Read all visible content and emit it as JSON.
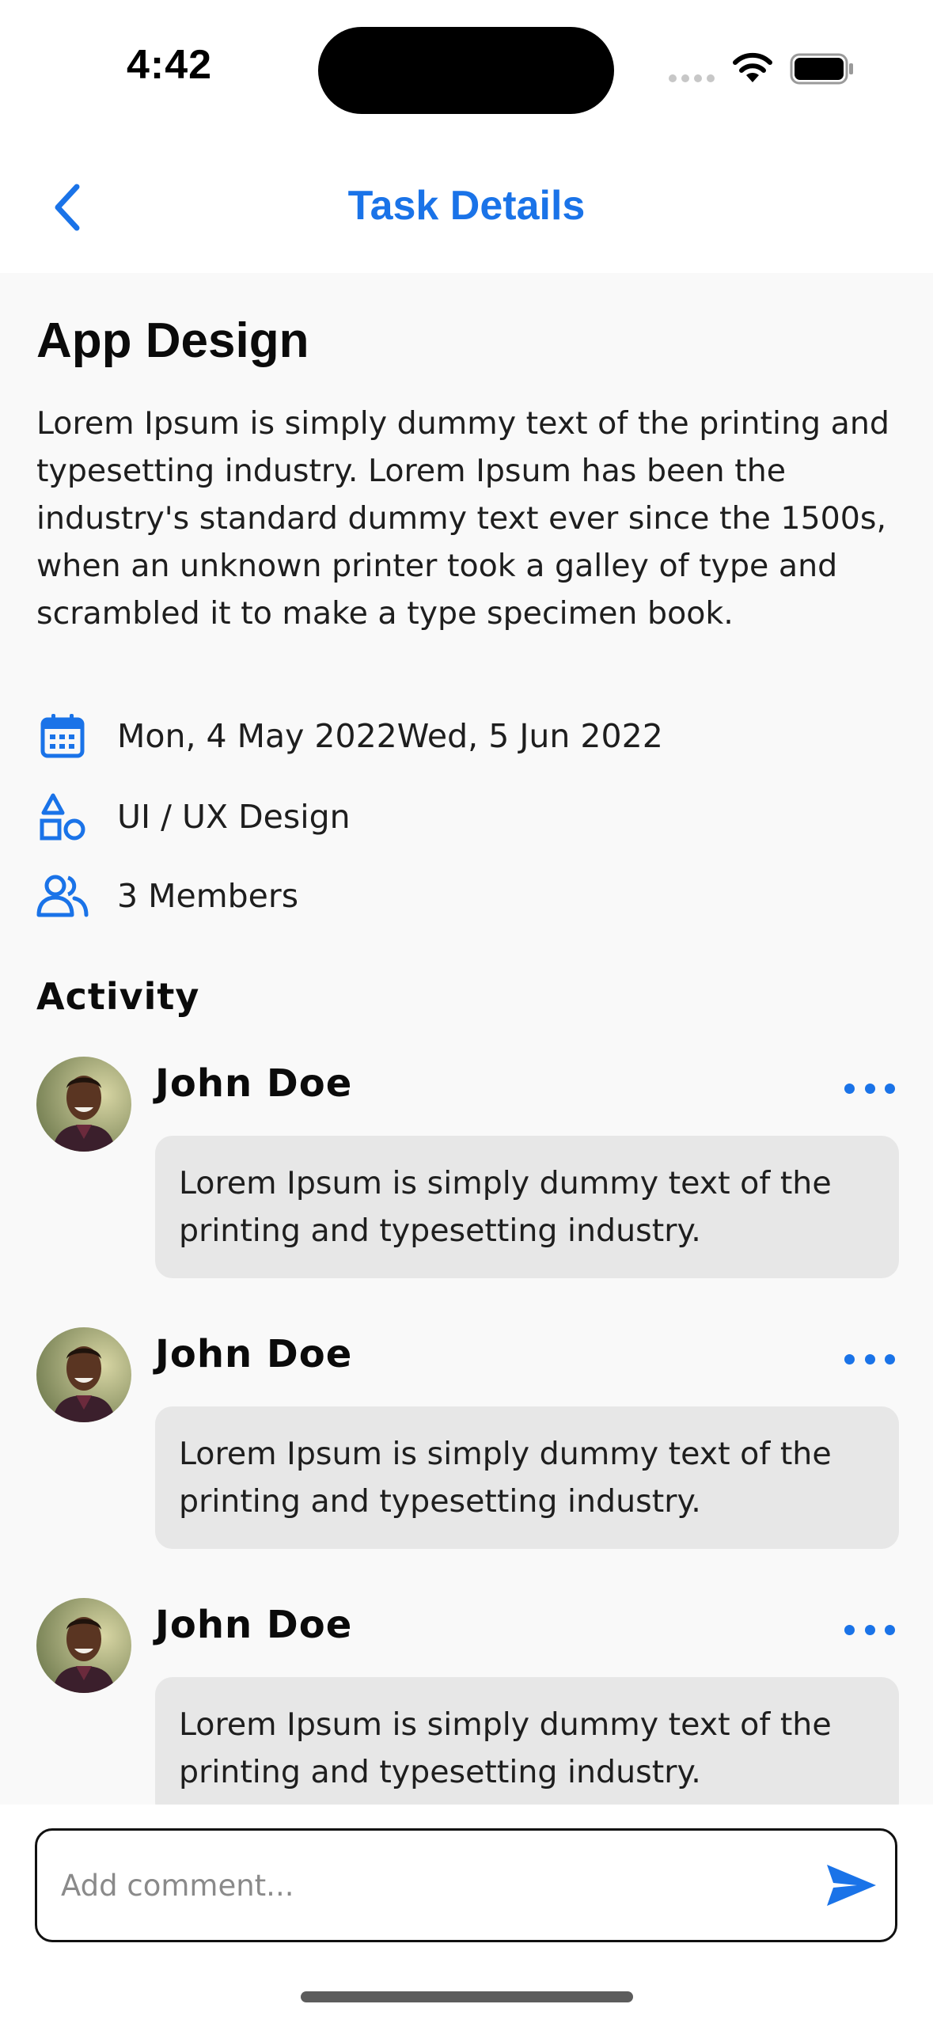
{
  "status_bar": {
    "time": "4:42",
    "icons": [
      "cellular-signal-icon",
      "wifi-icon",
      "battery-icon"
    ]
  },
  "nav": {
    "back_icon": "chevron-left-icon",
    "title": "Task Details"
  },
  "task": {
    "title": "App Design",
    "description": "Lorem Ipsum is simply dummy text of the printing and typesetting industry. Lorem Ipsum has been the industry's standard dummy text ever since the 1500s, when an unknown printer took a galley of type and scrambled it to make a type specimen book.",
    "meta": [
      {
        "icon": "calendar-icon",
        "text": "Mon, 4 May 2022Wed, 5 Jun 2022"
      },
      {
        "icon": "shapes-icon",
        "text": "UI / UX Design"
      },
      {
        "icon": "members-icon",
        "text": "3 Members"
      }
    ]
  },
  "activity": {
    "heading": "Activity",
    "comments": [
      {
        "author": "John Doe",
        "text": "Lorem Ipsum is simply dummy text of the printing and typesetting industry."
      },
      {
        "author": "John Doe",
        "text": "Lorem Ipsum is simply dummy text of the printing and typesetting industry."
      },
      {
        "author": "John Doe",
        "text": "Lorem Ipsum is simply dummy text of the printing and typesetting industry."
      }
    ]
  },
  "comment_bar": {
    "placeholder": "Add comment...",
    "value": "",
    "send_icon": "send-icon"
  },
  "colors": {
    "accent": "#1a73e8",
    "background": "#f9f9f9",
    "bubble": "#e7e7e7",
    "text": "#1e1e1e"
  }
}
